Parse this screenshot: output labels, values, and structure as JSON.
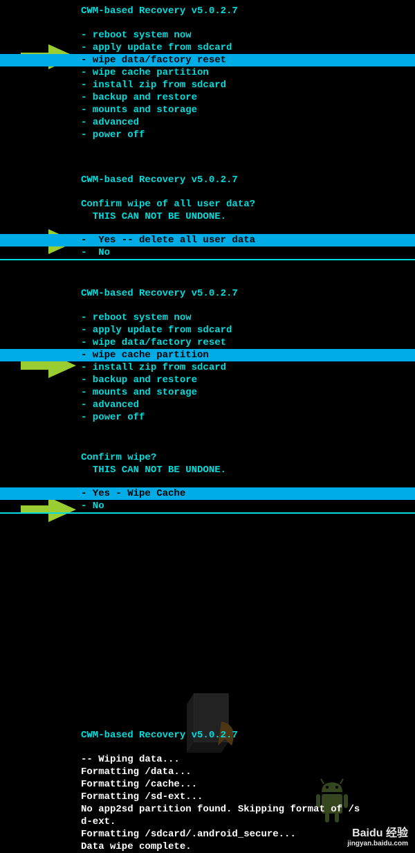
{
  "recovery_title": "CWM-based Recovery v5.0.2.7",
  "menu1": {
    "items": [
      "- reboot system now",
      "- apply update from sdcard",
      "- wipe data/factory reset",
      "- wipe cache partition",
      "- install zip from sdcard",
      "- backup and restore",
      "- mounts and storage",
      "- advanced",
      "- power off"
    ],
    "selected_index": 2
  },
  "confirm1": {
    "prompt": "Confirm wipe of all user data?",
    "warning": "  THIS CAN NOT BE UNDONE.",
    "options": [
      "-  Yes -- delete all user data",
      "-  No"
    ],
    "selected_index": 0
  },
  "menu2": {
    "items": [
      "- reboot system now",
      "- apply update from sdcard",
      "- wipe data/factory reset",
      "- wipe cache partition",
      "- install zip from sdcard",
      "- backup and restore",
      "- mounts and storage",
      "- advanced",
      "- power off"
    ],
    "selected_index": 3
  },
  "confirm2": {
    "prompt": "Confirm wipe?",
    "warning": "  THIS CAN NOT BE UNDONE.",
    "options": [
      "- Yes - Wipe Cache",
      "- No"
    ],
    "selected_index": 0
  },
  "log": {
    "lines": [
      "-- Wiping data...",
      "Formatting /data...",
      "Formatting /cache...",
      "Formatting /sd-ext...",
      "No app2sd partition found. Skipping format of /s",
      "d-ext.",
      "Formatting /sdcard/.android_secure...",
      "Data wipe complete."
    ]
  },
  "watermark": {
    "logo": "Baidu 经验",
    "url": "jingyan.baidu.com"
  }
}
